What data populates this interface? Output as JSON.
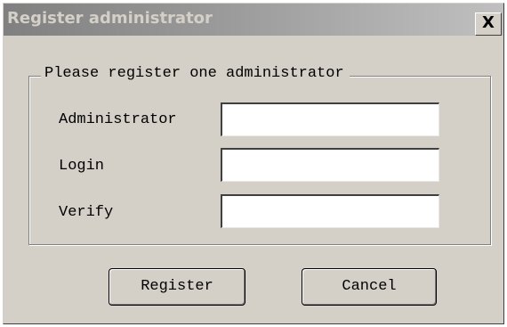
{
  "window": {
    "title": "Register administrator",
    "close_label": "X"
  },
  "form": {
    "group_title": "Please register one administrator",
    "fields": [
      {
        "label": "Administrator",
        "value": "",
        "placeholder": ""
      },
      {
        "label": "Login",
        "value": "",
        "placeholder": ""
      },
      {
        "label": "Verify",
        "value": "",
        "placeholder": ""
      }
    ]
  },
  "buttons": {
    "register_label": "Register",
    "cancel_label": "Cancel"
  }
}
